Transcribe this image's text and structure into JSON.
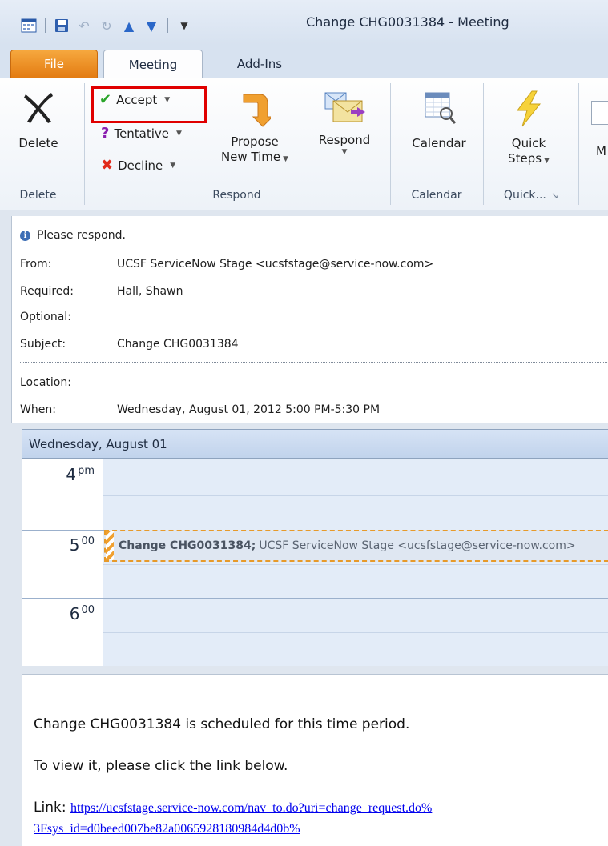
{
  "window": {
    "title": "Change CHG0031384  -  Meeting"
  },
  "tabs": {
    "file": "File",
    "meeting": "Meeting",
    "addins": "Add-Ins"
  },
  "ribbon": {
    "delete": {
      "label": "Delete",
      "group": "Delete"
    },
    "respond": {
      "accept": "Accept",
      "tentative": "Tentative",
      "decline": "Decline",
      "propose_line1": "Propose",
      "propose_line2": "New Time",
      "respond": "Respond",
      "group": "Respond"
    },
    "calendar": {
      "label": "Calendar",
      "group": "Calendar"
    },
    "quick": {
      "line1": "Quick",
      "line2": "Steps",
      "group": "Quick..."
    },
    "more_partial": "M",
    "colors": {
      "accent_highlight": "#e00000",
      "file_tab": "#e37b12"
    }
  },
  "header": {
    "info": "Please respond.",
    "from_label": "From:",
    "from_value": "UCSF ServiceNow Stage <ucsfstage@service-now.com>",
    "required_label": "Required:",
    "required_value": "Hall, Shawn",
    "optional_label": "Optional:",
    "subject_label": "Subject:",
    "subject_value": "Change CHG0031384",
    "location_label": "Location:",
    "when_label": "When:",
    "when_value": "Wednesday, August 01, 2012 5:00 PM-5:30 PM"
  },
  "calendar_preview": {
    "day_header": "Wednesday, August 01",
    "hours": [
      {
        "num": "4",
        "suffix": "pm"
      },
      {
        "num": "5",
        "suffix": "00"
      },
      {
        "num": "6",
        "suffix": "00"
      }
    ],
    "appointment_subject": "Change CHG0031384;",
    "appointment_organizer": "UCSF ServiceNow Stage <ucsfstage@service-now.com>"
  },
  "body": {
    "line1": "Change CHG0031384 is scheduled for this time period.",
    "line2": "To view it, please click the link below.",
    "link_label": "Link:",
    "link_line1": "https://ucsfstage.service-now.com/nav_to.do?uri=change_request.do%",
    "link_line2": "3Fsys_id=d0beed007be82a0065928180984d4d0b%"
  }
}
